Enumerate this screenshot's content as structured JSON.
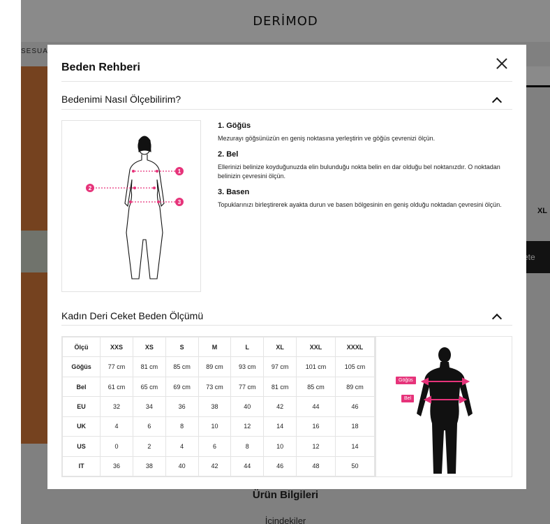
{
  "page": {
    "brand": "DERİMOD",
    "category_nav": "SESUA",
    "size_label": "XL",
    "cart_button_label": "ete",
    "product_info_title": "Ürün Bilgileri",
    "product_info_sub": "İçindekiler"
  },
  "modal": {
    "title": "Beden Rehberi",
    "how_to_measure": {
      "title": "Bedenimi Nasıl Ölçebilirim?",
      "steps": [
        {
          "title": "1. Göğüs",
          "text": "Mezurayı göğsünüzün en geniş noktasına yerleştirin ve göğüs çevrenizi ölçün."
        },
        {
          "title": "2. Bel",
          "text": "Ellerinizi belinize koyduğunuzda elin bulunduğu nokta belin en dar olduğu bel noktanızdır. O noktadan belinizin çevresini ölçün."
        },
        {
          "title": "3. Basen",
          "text": "Topuklarınızı birleştirerek ayakta durun ve basen bölgesinin en geniş olduğu noktadan çevresini ölçün."
        }
      ],
      "markers": [
        "1",
        "2",
        "3"
      ]
    },
    "size_chart": {
      "title": "Kadın Deri Ceket Beden Ölçümü",
      "header": [
        "Ölçü",
        "XXS",
        "XS",
        "S",
        "M",
        "L",
        "XL",
        "XXL",
        "XXXL"
      ],
      "rows": [
        [
          "Göğüs",
          "77 cm",
          "81 cm",
          "85 cm",
          "89 cm",
          "93 cm",
          "97 cm",
          "101 cm",
          "105 cm"
        ],
        [
          "Bel",
          "61 cm",
          "65 cm",
          "69 cm",
          "73 cm",
          "77 cm",
          "81 cm",
          "85 cm",
          "89 cm"
        ],
        [
          "EU",
          "32",
          "34",
          "36",
          "38",
          "40",
          "42",
          "44",
          "46"
        ],
        [
          "UK",
          "4",
          "6",
          "8",
          "10",
          "12",
          "14",
          "16",
          "18"
        ],
        [
          "US",
          "0",
          "2",
          "4",
          "6",
          "8",
          "10",
          "12",
          "14"
        ],
        [
          "IT",
          "36",
          "38",
          "40",
          "42",
          "44",
          "46",
          "48",
          "50"
        ]
      ],
      "diagram_labels": {
        "chest": "Göğüs",
        "waist": "Bel"
      }
    }
  },
  "colors": {
    "accent": "#e6337a",
    "overlay": "rgba(0,0,0,0.46)"
  }
}
